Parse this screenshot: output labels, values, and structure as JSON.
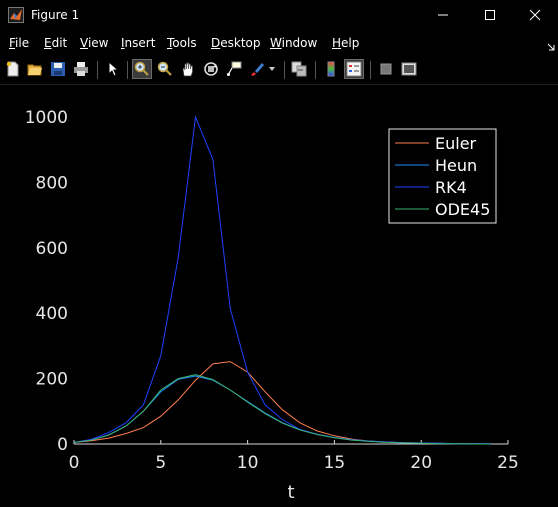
{
  "window": {
    "title": "Figure 1"
  },
  "menubar": {
    "items": [
      {
        "label": "File",
        "u": "F",
        "rest": "ile"
      },
      {
        "label": "Edit",
        "u": "E",
        "rest": "dit"
      },
      {
        "label": "View",
        "u": "V",
        "rest": "iew"
      },
      {
        "label": "Insert",
        "u": "I",
        "rest": "nsert"
      },
      {
        "label": "Tools",
        "u": "T",
        "rest": "ools"
      },
      {
        "label": "Desktop",
        "u": "D",
        "rest": "esktop"
      },
      {
        "label": "Window",
        "u": "W",
        "rest": "indow"
      },
      {
        "label": "Help",
        "u": "H",
        "rest": "elp"
      }
    ]
  },
  "toolbar": {
    "icons": [
      "new-figure-icon",
      "open-file-icon",
      "save-icon",
      "print-icon",
      "pointer-icon",
      "zoom-in-icon",
      "zoom-out-icon",
      "pan-icon",
      "rotate-3d-icon",
      "data-cursor-icon",
      "brush-icon",
      "dropdown-arrow-icon",
      "link-plot-icon",
      "insert-colorbar-icon",
      "insert-legend-icon",
      "hide-plot-tools-icon",
      "show-plot-tools-icon"
    ]
  },
  "chart_data": {
    "type": "line",
    "xlabel": "t",
    "ylabel": "",
    "title": "",
    "xlim": [
      0,
      25
    ],
    "ylim": [
      0,
      1000
    ],
    "xticks": [
      "0",
      "5",
      "10",
      "15",
      "20",
      "25"
    ],
    "yticks": [
      "0",
      "200",
      "400",
      "600",
      "800",
      "1000"
    ],
    "grid": false,
    "legend_position": "top-right",
    "series": [
      {
        "name": "Euler",
        "color": "#ff7f50",
        "x": [
          0,
          1,
          2,
          3,
          4,
          5,
          6,
          7,
          8,
          9,
          10,
          11,
          12,
          13,
          14,
          15,
          16,
          17,
          18,
          19,
          20,
          21,
          22,
          23,
          24
        ],
        "y": [
          5,
          10,
          18,
          32,
          50,
          85,
          135,
          195,
          245,
          252,
          220,
          160,
          105,
          65,
          40,
          25,
          15,
          9,
          6,
          4,
          3,
          2,
          1,
          1,
          0
        ]
      },
      {
        "name": "Heun",
        "color": "#1e90ff",
        "x": [
          0,
          1,
          2,
          3,
          4,
          5,
          6,
          7,
          8,
          9,
          10,
          11,
          12,
          13,
          14,
          15,
          16,
          17,
          18,
          19,
          20,
          21,
          22,
          23,
          24
        ],
        "y": [
          5,
          12,
          28,
          55,
          100,
          160,
          198,
          208,
          195,
          165,
          130,
          95,
          65,
          44,
          30,
          20,
          13,
          9,
          6,
          4,
          3,
          2,
          1,
          1,
          1
        ]
      },
      {
        "name": "RK4",
        "color": "#2040ff",
        "x": [
          0,
          1,
          2,
          3,
          4,
          5,
          6,
          7,
          8,
          9,
          10,
          11,
          12,
          13,
          14,
          15,
          16,
          17,
          18,
          19,
          20,
          21,
          22,
          23,
          24
        ],
        "y": [
          5,
          14,
          35,
          65,
          120,
          270,
          570,
          1000,
          870,
          415,
          220,
          120,
          75,
          45,
          30,
          20,
          13,
          9,
          6,
          4,
          3,
          2,
          1,
          1,
          1
        ]
      },
      {
        "name": "ODE45",
        "color": "#3cb371",
        "x": [
          0,
          1,
          2,
          3,
          4,
          5,
          6,
          7,
          8,
          9,
          10,
          11,
          12,
          13,
          14,
          15,
          16,
          17,
          18,
          19,
          20,
          21,
          22,
          23,
          24
        ],
        "y": [
          5,
          12,
          27,
          55,
          100,
          165,
          200,
          212,
          197,
          165,
          128,
          93,
          64,
          43,
          29,
          19,
          12,
          8,
          5,
          3,
          2,
          1,
          1,
          0,
          0
        ]
      }
    ]
  }
}
